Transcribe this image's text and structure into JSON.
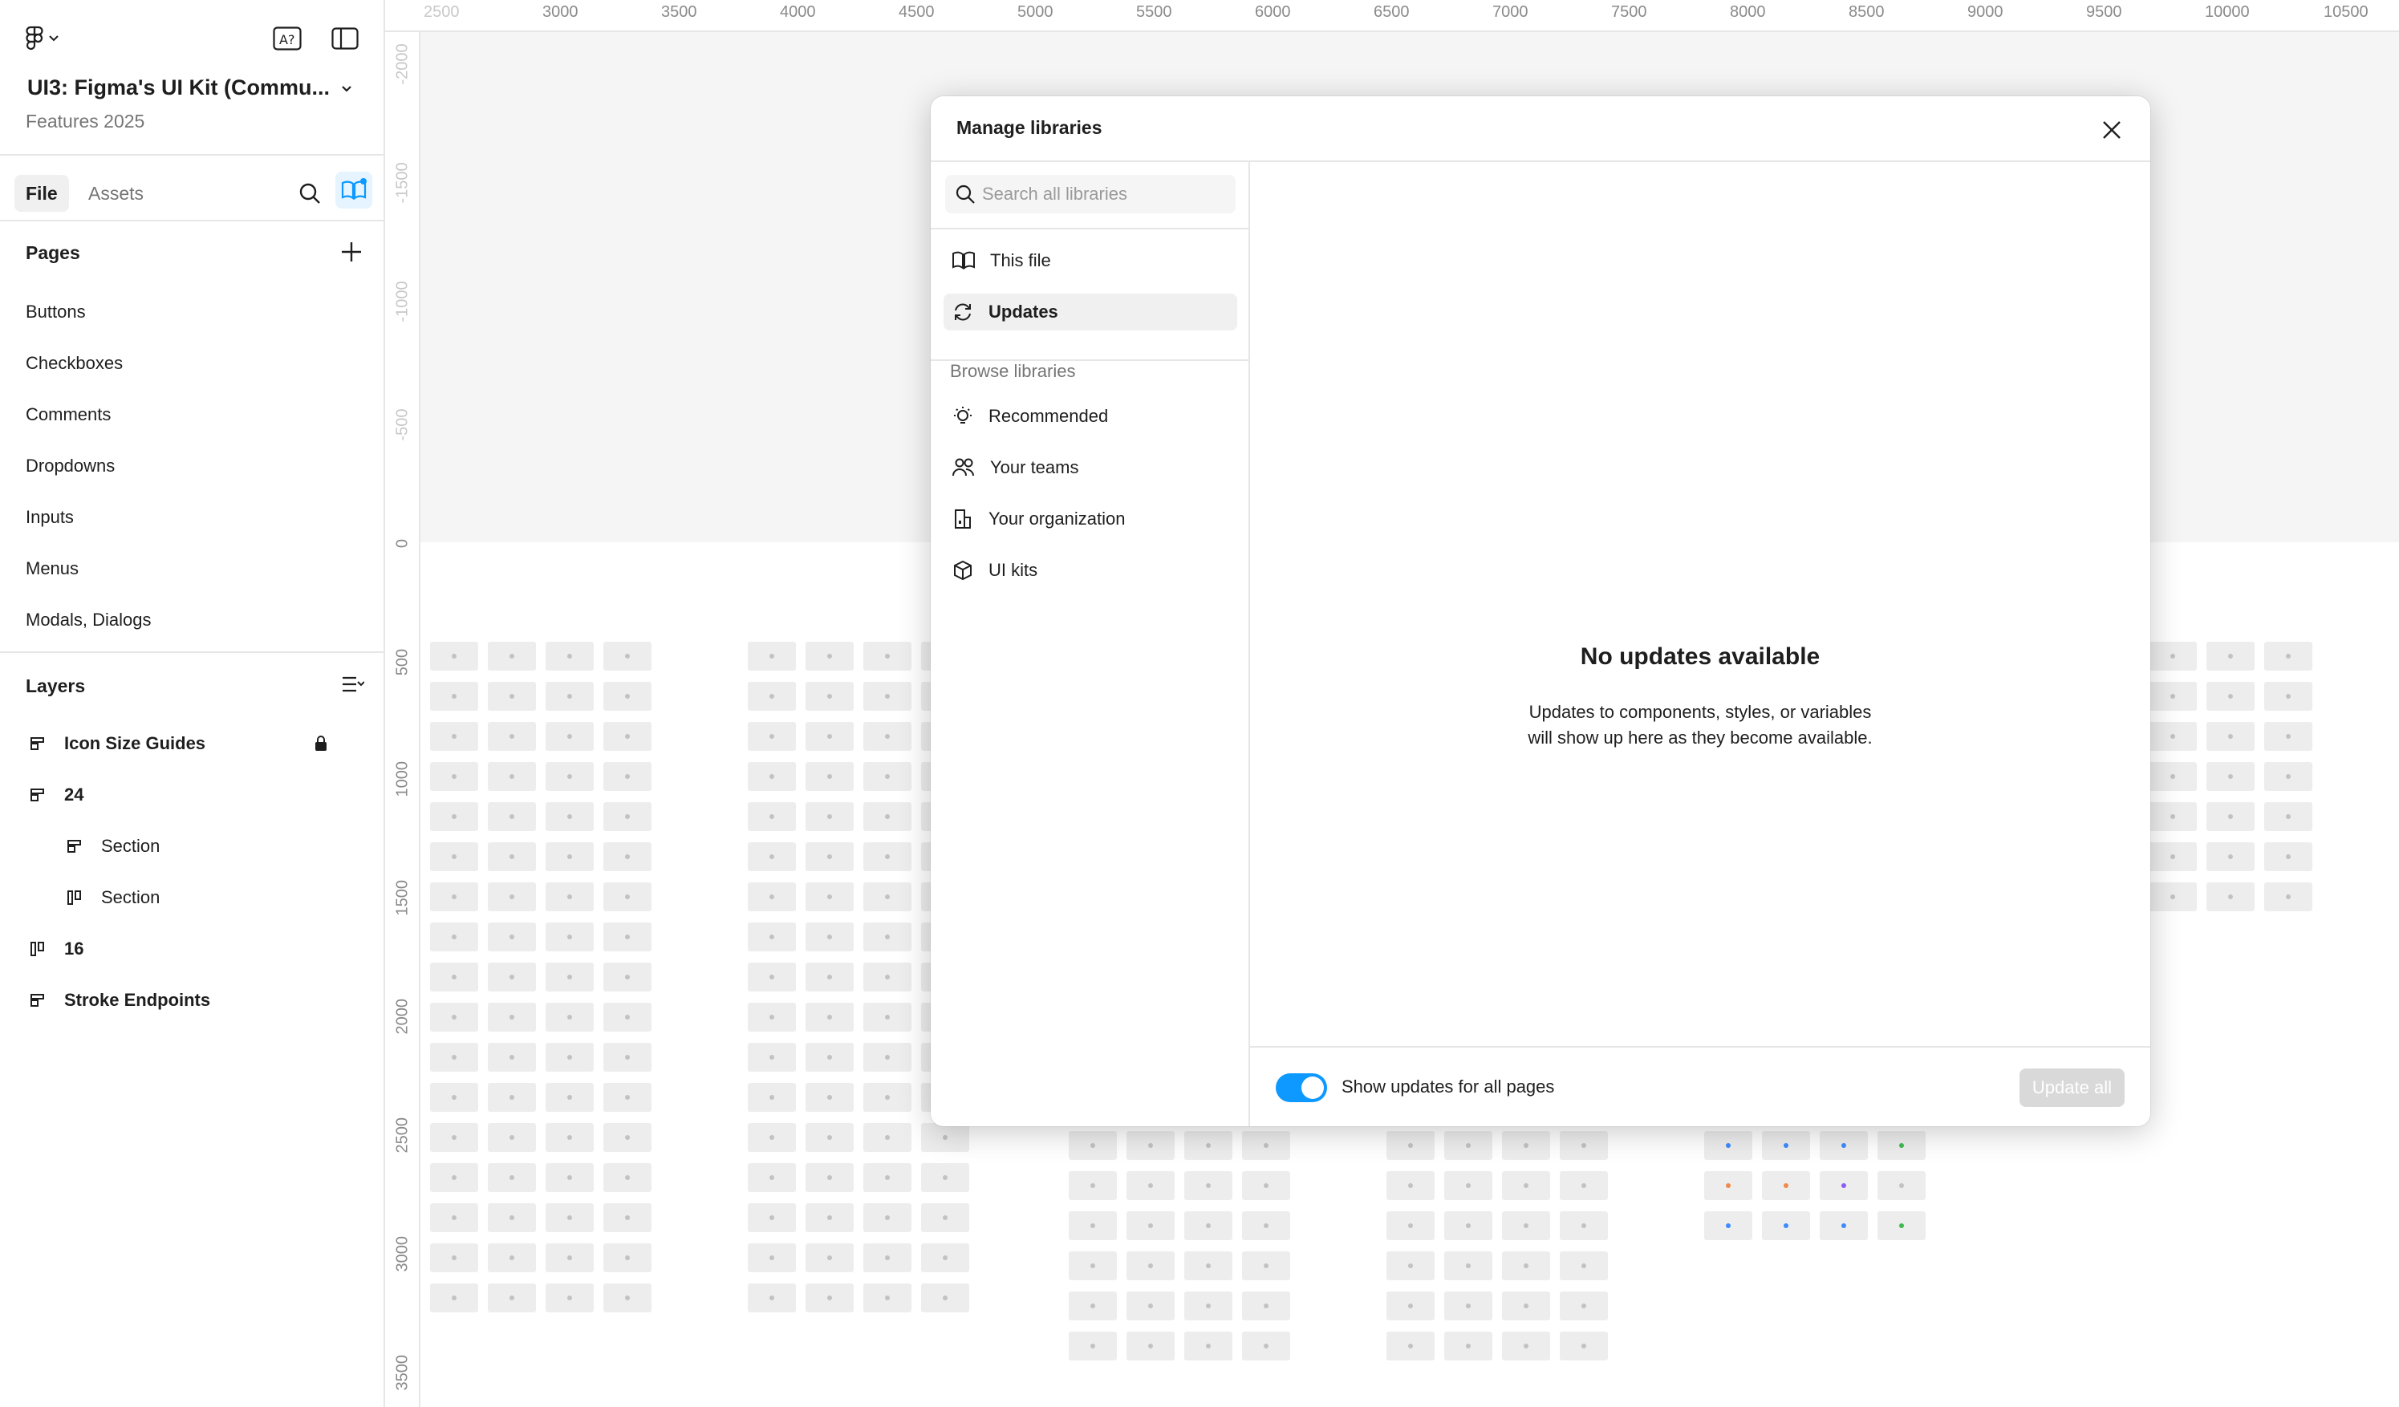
{
  "file": {
    "title": "UI3: Figma's UI Kit (Commu...",
    "subtitle": "Features 2025"
  },
  "tabs": [
    {
      "label": "File",
      "active": true
    },
    {
      "label": "Assets",
      "active": false
    }
  ],
  "pages": {
    "title": "Pages",
    "items": [
      "Buttons",
      "Checkboxes",
      "Comments",
      "Dropdowns",
      "Inputs",
      "Menus",
      "Modals, Dialogs"
    ]
  },
  "layers": {
    "title": "Layers",
    "items": [
      {
        "label": "Icon Size Guides",
        "icon": "section-icon",
        "bold": true,
        "locked": true,
        "indent": 0
      },
      {
        "label": "24",
        "icon": "section-icon",
        "bold": true,
        "locked": false,
        "indent": 0
      },
      {
        "label": "Section",
        "icon": "section-icon",
        "bold": false,
        "locked": false,
        "indent": 1
      },
      {
        "label": "Section",
        "icon": "frame-icon",
        "bold": false,
        "locked": false,
        "indent": 1
      },
      {
        "label": "16",
        "icon": "frame-icon",
        "bold": true,
        "locked": false,
        "indent": 0
      },
      {
        "label": "Stroke Endpoints",
        "icon": "section-icon",
        "bold": true,
        "locked": false,
        "indent": 0
      }
    ]
  },
  "rulers": {
    "top": [
      "2500",
      "3000",
      "3500",
      "4000",
      "4500",
      "5000",
      "5500",
      "6000",
      "6500",
      "7000",
      "7500",
      "8000",
      "8500",
      "9000",
      "9500",
      "10000",
      "10500"
    ],
    "left": [
      "-2000",
      "-1500",
      "-1000",
      "-500",
      "0",
      "500",
      "1000",
      "1500",
      "2000",
      "2500",
      "3000",
      "3500"
    ]
  },
  "modal": {
    "title": "Manage libraries",
    "search_placeholder": "Search all libraries",
    "nav_top": [
      {
        "label": "This file",
        "icon": "book-icon",
        "selected": false
      },
      {
        "label": "Updates",
        "icon": "refresh-icon",
        "selected": true
      }
    ],
    "browse_title": "Browse libraries",
    "nav_browse": [
      {
        "label": "Recommended",
        "icon": "lightbulb-icon"
      },
      {
        "label": "Your teams",
        "icon": "people-icon"
      },
      {
        "label": "Your organization",
        "icon": "building-icon"
      },
      {
        "label": "UI kits",
        "icon": "package-icon"
      }
    ],
    "empty_title": "No updates available",
    "empty_desc_line1": "Updates to components, styles, or variables",
    "empty_desc_line2": "will show up here as they become available.",
    "toggle_label": "Show updates for all pages",
    "toggle_on": true,
    "update_button": "Update all"
  },
  "colors": {
    "accent": "#0d99ff",
    "selected_bg": "#f0f0f0",
    "border": "#e6e6e6",
    "muted_text": "#757575"
  }
}
